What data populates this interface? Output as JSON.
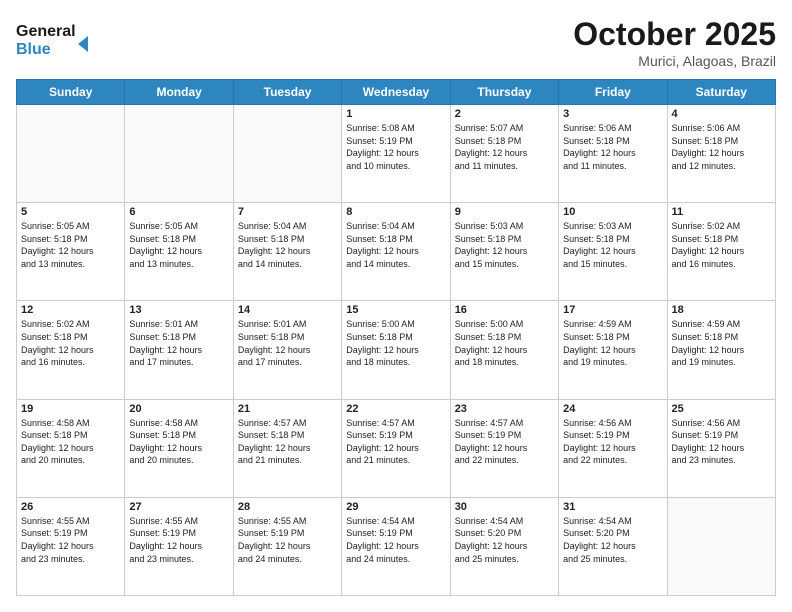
{
  "header": {
    "logo_line1": "General",
    "logo_line2": "Blue",
    "month": "October 2025",
    "location": "Murici, Alagoas, Brazil"
  },
  "weekdays": [
    "Sunday",
    "Monday",
    "Tuesday",
    "Wednesday",
    "Thursday",
    "Friday",
    "Saturday"
  ],
  "weeks": [
    [
      {
        "day": "",
        "info": ""
      },
      {
        "day": "",
        "info": ""
      },
      {
        "day": "",
        "info": ""
      },
      {
        "day": "1",
        "info": "Sunrise: 5:08 AM\nSunset: 5:19 PM\nDaylight: 12 hours\nand 10 minutes."
      },
      {
        "day": "2",
        "info": "Sunrise: 5:07 AM\nSunset: 5:18 PM\nDaylight: 12 hours\nand 11 minutes."
      },
      {
        "day": "3",
        "info": "Sunrise: 5:06 AM\nSunset: 5:18 PM\nDaylight: 12 hours\nand 11 minutes."
      },
      {
        "day": "4",
        "info": "Sunrise: 5:06 AM\nSunset: 5:18 PM\nDaylight: 12 hours\nand 12 minutes."
      }
    ],
    [
      {
        "day": "5",
        "info": "Sunrise: 5:05 AM\nSunset: 5:18 PM\nDaylight: 12 hours\nand 13 minutes."
      },
      {
        "day": "6",
        "info": "Sunrise: 5:05 AM\nSunset: 5:18 PM\nDaylight: 12 hours\nand 13 minutes."
      },
      {
        "day": "7",
        "info": "Sunrise: 5:04 AM\nSunset: 5:18 PM\nDaylight: 12 hours\nand 14 minutes."
      },
      {
        "day": "8",
        "info": "Sunrise: 5:04 AM\nSunset: 5:18 PM\nDaylight: 12 hours\nand 14 minutes."
      },
      {
        "day": "9",
        "info": "Sunrise: 5:03 AM\nSunset: 5:18 PM\nDaylight: 12 hours\nand 15 minutes."
      },
      {
        "day": "10",
        "info": "Sunrise: 5:03 AM\nSunset: 5:18 PM\nDaylight: 12 hours\nand 15 minutes."
      },
      {
        "day": "11",
        "info": "Sunrise: 5:02 AM\nSunset: 5:18 PM\nDaylight: 12 hours\nand 16 minutes."
      }
    ],
    [
      {
        "day": "12",
        "info": "Sunrise: 5:02 AM\nSunset: 5:18 PM\nDaylight: 12 hours\nand 16 minutes."
      },
      {
        "day": "13",
        "info": "Sunrise: 5:01 AM\nSunset: 5:18 PM\nDaylight: 12 hours\nand 17 minutes."
      },
      {
        "day": "14",
        "info": "Sunrise: 5:01 AM\nSunset: 5:18 PM\nDaylight: 12 hours\nand 17 minutes."
      },
      {
        "day": "15",
        "info": "Sunrise: 5:00 AM\nSunset: 5:18 PM\nDaylight: 12 hours\nand 18 minutes."
      },
      {
        "day": "16",
        "info": "Sunrise: 5:00 AM\nSunset: 5:18 PM\nDaylight: 12 hours\nand 18 minutes."
      },
      {
        "day": "17",
        "info": "Sunrise: 4:59 AM\nSunset: 5:18 PM\nDaylight: 12 hours\nand 19 minutes."
      },
      {
        "day": "18",
        "info": "Sunrise: 4:59 AM\nSunset: 5:18 PM\nDaylight: 12 hours\nand 19 minutes."
      }
    ],
    [
      {
        "day": "19",
        "info": "Sunrise: 4:58 AM\nSunset: 5:18 PM\nDaylight: 12 hours\nand 20 minutes."
      },
      {
        "day": "20",
        "info": "Sunrise: 4:58 AM\nSunset: 5:18 PM\nDaylight: 12 hours\nand 20 minutes."
      },
      {
        "day": "21",
        "info": "Sunrise: 4:57 AM\nSunset: 5:18 PM\nDaylight: 12 hours\nand 21 minutes."
      },
      {
        "day": "22",
        "info": "Sunrise: 4:57 AM\nSunset: 5:19 PM\nDaylight: 12 hours\nand 21 minutes."
      },
      {
        "day": "23",
        "info": "Sunrise: 4:57 AM\nSunset: 5:19 PM\nDaylight: 12 hours\nand 22 minutes."
      },
      {
        "day": "24",
        "info": "Sunrise: 4:56 AM\nSunset: 5:19 PM\nDaylight: 12 hours\nand 22 minutes."
      },
      {
        "day": "25",
        "info": "Sunrise: 4:56 AM\nSunset: 5:19 PM\nDaylight: 12 hours\nand 23 minutes."
      }
    ],
    [
      {
        "day": "26",
        "info": "Sunrise: 4:55 AM\nSunset: 5:19 PM\nDaylight: 12 hours\nand 23 minutes."
      },
      {
        "day": "27",
        "info": "Sunrise: 4:55 AM\nSunset: 5:19 PM\nDaylight: 12 hours\nand 23 minutes."
      },
      {
        "day": "28",
        "info": "Sunrise: 4:55 AM\nSunset: 5:19 PM\nDaylight: 12 hours\nand 24 minutes."
      },
      {
        "day": "29",
        "info": "Sunrise: 4:54 AM\nSunset: 5:19 PM\nDaylight: 12 hours\nand 24 minutes."
      },
      {
        "day": "30",
        "info": "Sunrise: 4:54 AM\nSunset: 5:20 PM\nDaylight: 12 hours\nand 25 minutes."
      },
      {
        "day": "31",
        "info": "Sunrise: 4:54 AM\nSunset: 5:20 PM\nDaylight: 12 hours\nand 25 minutes."
      },
      {
        "day": "",
        "info": ""
      }
    ]
  ]
}
